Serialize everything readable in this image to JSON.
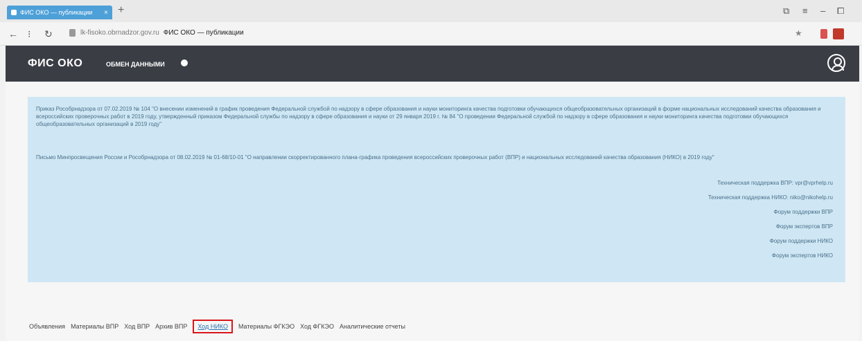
{
  "browser": {
    "tab_title": "ФИС ОКО — публикации",
    "tab_close": "×",
    "new_tab": "+",
    "url_domain": "lk-fisoko.obrnadzor.gov.ru",
    "url_page": "ФИС ОКО — публикации",
    "back": "←",
    "reload": "↻"
  },
  "header": {
    "brand": "ФИС ОКО",
    "exchange": "ОБМЕН ДАННЫМИ"
  },
  "info": {
    "paragraph1": "Приказ Рособрнадзора от 07.02.2019 № 104 \"О внесении изменений в график проведения Федеральной службой по надзору в сфере образования и науки мониторинга качества подготовки обучающихся общеобразовательных организаций в форме национальных исследований качества образования и всероссийских проверочных работ в 2019 году, утвержденный приказом Федеральной службы по надзору в сфере образования и науки от 29 января 2019 г. № 84 \"О проведении Федеральной службой по надзору в сфере образования и науки мониторинга качества подготовки обучающихся общеобразовательных организаций в 2019 году\"",
    "paragraph2": "Письмо Минпросвещения России и Рособрнадзора от 08.02.2019 № 01-68/10-01 \"О направлении скорректированного плана-графика проведения всероссийских проверочных работ (ВПР) и национальных исследований качества образования (НИКО) в 2019 году\"",
    "links": [
      "Техническая поддержка ВПР: vpr@vprhelp.ru",
      "Техническая поддержка НИКО: niko@nikohelp.ru",
      "Форум поддержки ВПР",
      "Форум экспертов ВПР",
      "Форум поддержки НИКО",
      "Форум экспертов НИКО"
    ]
  },
  "nav": [
    "Объявления",
    "Материалы ВПР",
    "Ход ВПР",
    "Архив ВПР",
    "Ход НИКО",
    "Материалы ФГКЭО",
    "Ход ФГКЭО",
    "Аналитические отчеты"
  ],
  "highlight_color": "#d9161a"
}
